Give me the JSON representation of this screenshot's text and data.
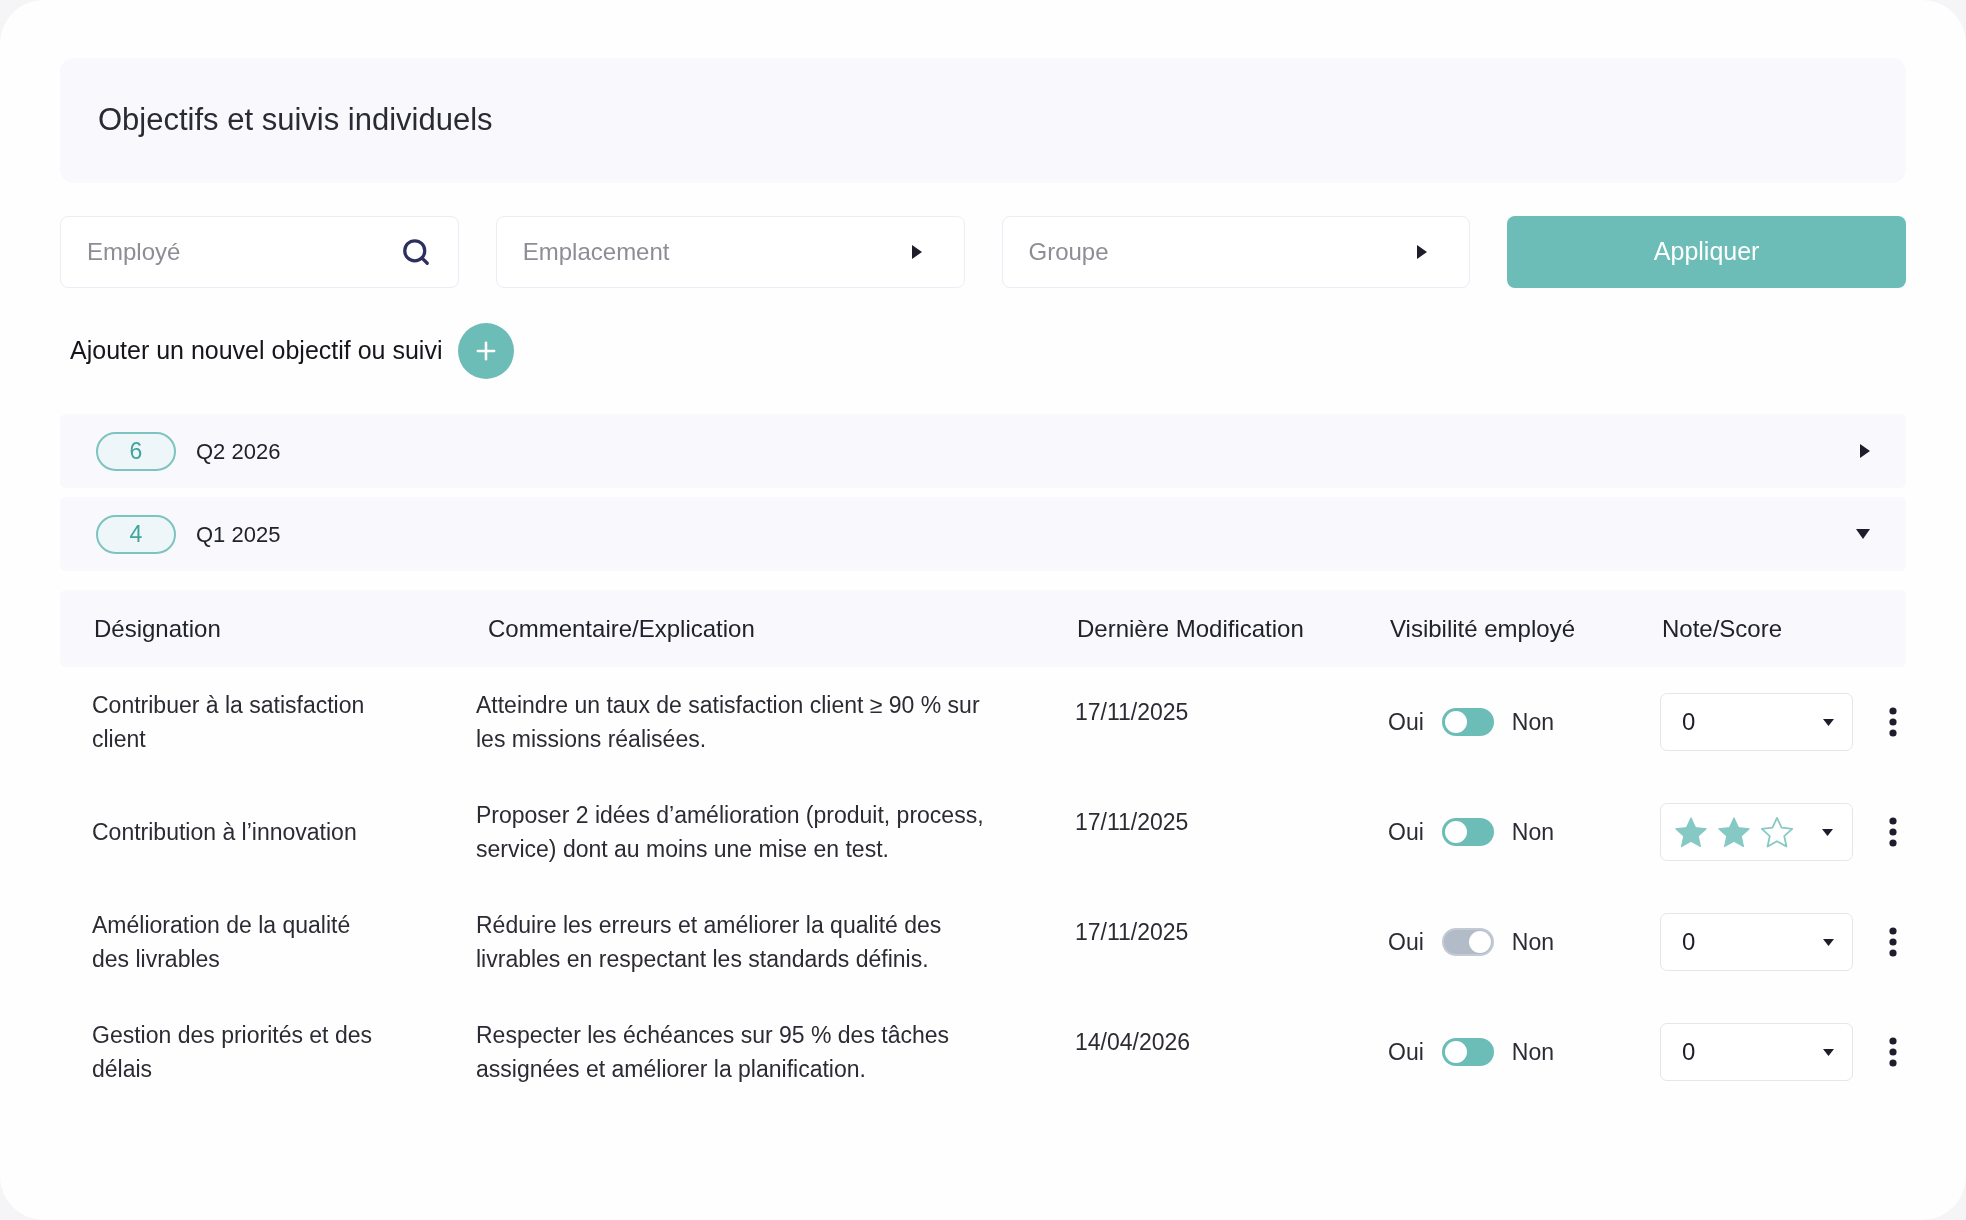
{
  "page": {
    "title": "Objectifs et suivis individuels"
  },
  "filters": [
    {
      "kind": "search",
      "placeholder": "Employé"
    },
    {
      "kind": "select",
      "placeholder": "Emplacement"
    },
    {
      "kind": "select",
      "placeholder": "Groupe"
    }
  ],
  "apply_button": {
    "label": "Appliquer"
  },
  "add_action": {
    "label": "Ajouter un nouvel objectif ou suivi"
  },
  "groups": [
    {
      "count": "6",
      "label": "Q2 2026",
      "expanded": false
    },
    {
      "count": "4",
      "label": "Q1 2025",
      "expanded": true
    }
  ],
  "table": {
    "columns": [
      "Désignation",
      "Commentaire/Explication",
      "Dernière Modification",
      "Visibilité employé",
      "Note/Score"
    ],
    "rows": [
      {
        "designation": "Contribuer à la satisfaction client",
        "comment": "Atteindre un taux de satisfaction client ≥ 90 % sur les missions réalisées.",
        "modified": "17/11/2025",
        "visibility": {
          "yes_label": "Oui",
          "no_label": "Non",
          "hidden": false
        },
        "score": {
          "kind": "number",
          "value": "0"
        }
      },
      {
        "designation": "Contribution à l’innovation",
        "comment": "Proposer 2 idées d’amélioration (produit, process, service) dont au moins une mise en test.",
        "modified": "17/11/2025",
        "visibility": {
          "yes_label": "Oui",
          "no_label": "Non",
          "hidden": false
        },
        "score": {
          "kind": "stars",
          "stars": 2
        }
      },
      {
        "designation": "Amélioration de la qualité des livrables",
        "comment": "Réduire les erreurs et améliorer la qualité des livrables en respectant les standards définis.",
        "modified": "17/11/2025",
        "visibility": {
          "yes_label": "Oui",
          "no_label": "Non",
          "hidden": true
        },
        "score": {
          "kind": "number",
          "value": "0"
        }
      },
      {
        "designation": "Gestion des priorités et des délais",
        "comment": "Respecter les échéances sur 95 % des tâches assignées et améliorer la planification.",
        "modified": "14/04/2026",
        "visibility": {
          "yes_label": "Oui",
          "no_label": "Non",
          "hidden": false
        },
        "score": {
          "kind": "number",
          "value": "0"
        }
      }
    ]
  }
}
